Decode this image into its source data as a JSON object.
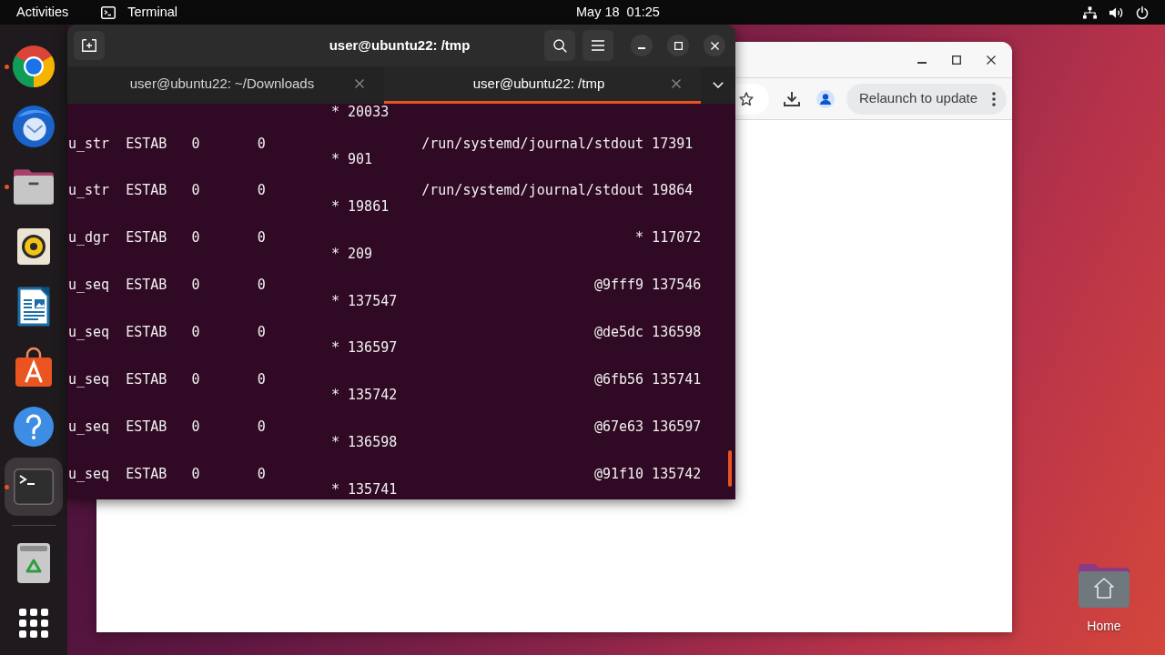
{
  "top_bar": {
    "activities": "Activities",
    "app_menu": "Terminal",
    "clock": "May 18  01:25"
  },
  "dock": {
    "apps": [
      {
        "kind": "browser",
        "running": true,
        "selected": false
      },
      {
        "kind": "mail",
        "running": false,
        "selected": false
      },
      {
        "kind": "files",
        "running": true,
        "selected": false
      },
      {
        "kind": "music",
        "running": false,
        "selected": false
      },
      {
        "kind": "writer",
        "running": false,
        "selected": false
      },
      {
        "kind": "store",
        "running": false,
        "selected": false
      },
      {
        "kind": "help",
        "running": false,
        "selected": false
      },
      {
        "kind": "terminal",
        "running": true,
        "selected": true
      }
    ],
    "extras": [
      {
        "kind": "trash"
      },
      {
        "kind": "app-grid"
      }
    ]
  },
  "browser_window": {
    "update_button": "Relaunch to update"
  },
  "terminal_window": {
    "title": "user@ubuntu22: /tmp",
    "tabs": [
      {
        "label": "user@ubuntu22: ~/Downloads",
        "selected": false
      },
      {
        "label": "user@ubuntu22: /tmp",
        "selected": true
      }
    ],
    "output": [
      {
        "kind": "continuation",
        "peer": "* 20033"
      },
      {
        "kind": "record",
        "netid": "u_str",
        "state": "ESTAB",
        "recv_q": "0",
        "send_q": "0",
        "local_address": "/run/systemd/journal/stdout",
        "local_port": "17391",
        "peer": "* 901"
      },
      {
        "kind": "record",
        "netid": "u_str",
        "state": "ESTAB",
        "recv_q": "0",
        "send_q": "0",
        "local_address": "/run/systemd/journal/stdout",
        "local_port": "19864",
        "peer": "* 19861"
      },
      {
        "kind": "record",
        "netid": "u_dgr",
        "state": "ESTAB",
        "recv_q": "0",
        "send_q": "0",
        "local_address": "*",
        "local_port": "117072",
        "peer": "* 209"
      },
      {
        "kind": "record",
        "netid": "u_seq",
        "state": "ESTAB",
        "recv_q": "0",
        "send_q": "0",
        "local_address": "@9fff9",
        "local_port": "137546",
        "peer": "* 137547"
      },
      {
        "kind": "record",
        "netid": "u_seq",
        "state": "ESTAB",
        "recv_q": "0",
        "send_q": "0",
        "local_address": "@de5dc",
        "local_port": "136598",
        "peer": "* 136597"
      },
      {
        "kind": "record",
        "netid": "u_seq",
        "state": "ESTAB",
        "recv_q": "0",
        "send_q": "0",
        "local_address": "@6fb56",
        "local_port": "135741",
        "peer": "* 135742"
      },
      {
        "kind": "record",
        "netid": "u_seq",
        "state": "ESTAB",
        "recv_q": "0",
        "send_q": "0",
        "local_address": "@67e63",
        "local_port": "136597",
        "peer": "* 136598"
      },
      {
        "kind": "record",
        "netid": "u_seq",
        "state": "ESTAB",
        "recv_q": "0",
        "send_q": "0",
        "local_address": "@91f10",
        "local_port": "135742",
        "peer": "* 135741"
      }
    ]
  },
  "desktop_icons": [
    {
      "kind": "home",
      "label": "Home"
    }
  ]
}
